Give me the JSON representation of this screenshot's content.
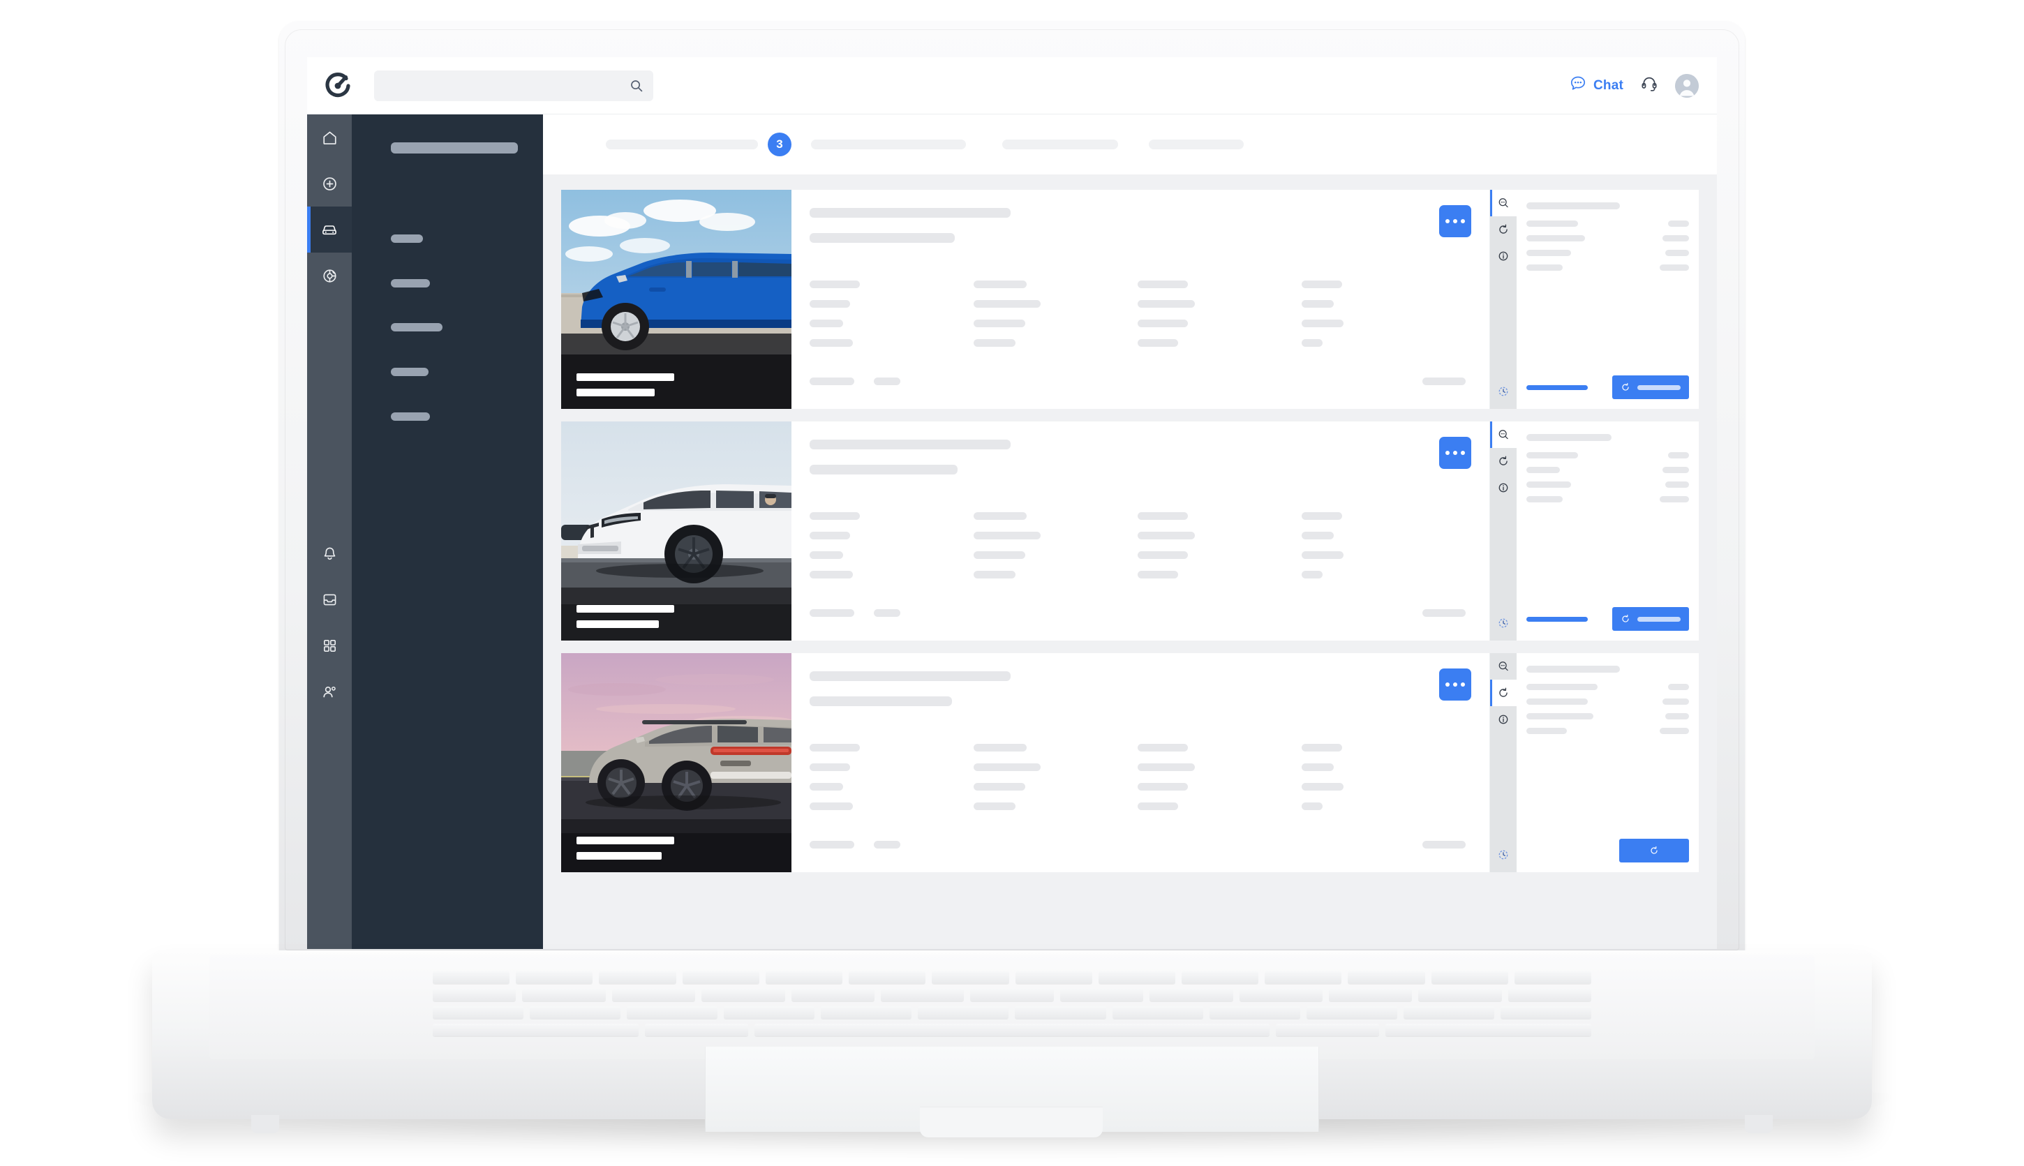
{
  "app": {
    "brand_logo_icon": "circle-c-logo-icon",
    "background": "#f0f1f3",
    "accent_color": "#3b7ef2",
    "nav_dark_color": "#25303d",
    "rail_dark_color": "#4b545f"
  },
  "topbar": {
    "search": {
      "value": "",
      "placeholder": "",
      "icon": "search-icon"
    },
    "chat": {
      "label": "Chat",
      "icon": "chat-bubble-icon",
      "color": "#3b7ef2"
    },
    "support": {
      "icon": "headset-icon"
    },
    "account": {
      "icon": "user-avatar-icon"
    }
  },
  "icon_rail": {
    "items": [
      {
        "name": "home",
        "icon": "home-icon",
        "active": false
      },
      {
        "name": "add",
        "icon": "plus-circle-icon",
        "active": false
      },
      {
        "name": "vehicles",
        "icon": "car-icon",
        "active": true
      },
      {
        "name": "steering",
        "icon": "steering-target-icon",
        "active": false
      }
    ],
    "bottom_items": [
      {
        "name": "notifications",
        "icon": "bell-icon",
        "active": false
      },
      {
        "name": "inbox",
        "icon": "inbox-icon",
        "active": false
      },
      {
        "name": "apps",
        "icon": "grid-apps-icon",
        "active": false
      },
      {
        "name": "users",
        "icon": "users-icon",
        "active": false
      }
    ]
  },
  "nav_panel": {
    "title_placeholder_width": 182,
    "item_placeholder_widths": [
      46,
      56,
      74,
      54,
      56
    ]
  },
  "stepper": {
    "current_step": "3",
    "segment_widths": [
      218,
      222,
      166,
      136
    ]
  },
  "vehicle_cards": [
    {
      "photo": {
        "alt": "blue hatchback car by concrete wall",
        "sky_top": "#9ec7e3",
        "sky_bottom": "#cfe0ec",
        "body_color": "#1560c4",
        "ground_color": "#3b3b3d",
        "wall_color": "#c9c3b8",
        "caption_widths": [
          140,
          112
        ]
      },
      "menu_button": {
        "icon": "more-horizontal-icon",
        "dots": 3
      },
      "title_widths": [
        288,
        208
      ],
      "specs": [
        [
          72,
          58,
          48,
          62
        ],
        [
          76,
          96,
          74,
          60
        ],
        [
          72,
          82,
          72,
          58
        ],
        [
          58,
          46,
          60,
          30
        ]
      ],
      "footer_widths": [
        64,
        38,
        62
      ],
      "aside": {
        "rail_icons": [
          {
            "icon": "chat-search-icon",
            "active": true
          },
          {
            "icon": "refresh-circle-icon",
            "active": false
          },
          {
            "icon": "info-circle-icon",
            "active": false
          },
          {
            "icon": "history-clock-icon",
            "active": false
          }
        ],
        "heading_width": 134,
        "left_widths": [
          74,
          84,
          64,
          52
        ],
        "right_widths": [
          30,
          38,
          34,
          42
        ],
        "link_bar_width": 88,
        "cta": {
          "icon": "refresh-icon",
          "label_width": 62,
          "has_label": true
        }
      }
    },
    {
      "photo": {
        "alt": "white electric SUV on road",
        "sky_top": "#dfe7ef",
        "sky_bottom": "#eef1f3",
        "body_color": "#f2f3f5",
        "ground_color": "#4a4d52",
        "wall_color": "#d9dce0",
        "caption_widths": [
          140,
          118
        ]
      },
      "menu_button": {
        "icon": "more-horizontal-icon",
        "dots": 3
      },
      "title_widths": [
        288,
        212
      ],
      "specs": [
        [
          72,
          58,
          48,
          62
        ],
        [
          76,
          96,
          74,
          60
        ],
        [
          72,
          82,
          72,
          58
        ],
        [
          58,
          46,
          60,
          30
        ]
      ],
      "footer_widths": [
        64,
        38,
        62
      ],
      "aside": {
        "rail_icons": [
          {
            "icon": "chat-search-icon",
            "active": true
          },
          {
            "icon": "refresh-circle-icon",
            "active": false
          },
          {
            "icon": "info-circle-icon",
            "active": false
          },
          {
            "icon": "history-clock-icon",
            "active": false
          }
        ],
        "heading_width": 122,
        "left_widths": [
          74,
          48,
          64,
          52
        ],
        "right_widths": [
          30,
          38,
          34,
          42
        ],
        "link_bar_width": 88,
        "cta": {
          "icon": "refresh-icon",
          "label_width": 62,
          "has_label": true
        }
      }
    },
    {
      "photo": {
        "alt": "silver SUV rear view at sunset",
        "sky_top": "#d8b6cb",
        "sky_bottom": "#e9cbd2",
        "body_color": "#b6b3ac",
        "ground_color": "#33333a",
        "wall_color": "#8d8f8c",
        "caption_widths": [
          140,
          122
        ]
      },
      "menu_button": {
        "icon": "more-horizontal-icon",
        "dots": 3
      },
      "title_widths": [
        288,
        204
      ],
      "specs": [
        [
          72,
          58,
          48,
          62
        ],
        [
          76,
          96,
          74,
          60
        ],
        [
          72,
          82,
          72,
          58
        ],
        [
          58,
          46,
          60,
          30
        ]
      ],
      "footer_widths": [
        64,
        38,
        62
      ],
      "aside": {
        "rail_icons": [
          {
            "icon": "chat-search-icon",
            "active": false
          },
          {
            "icon": "refresh-circle-icon",
            "active": true
          },
          {
            "icon": "info-circle-icon",
            "active": false
          },
          {
            "icon": "history-clock-icon",
            "active": false
          }
        ],
        "heading_width": 134,
        "left_widths": [
          102,
          88,
          96,
          58
        ],
        "right_widths": [
          30,
          38,
          34,
          42
        ],
        "link_bar_width": 0,
        "cta": {
          "icon": "refresh-icon",
          "label_width": 0,
          "has_label": false
        }
      }
    }
  ]
}
